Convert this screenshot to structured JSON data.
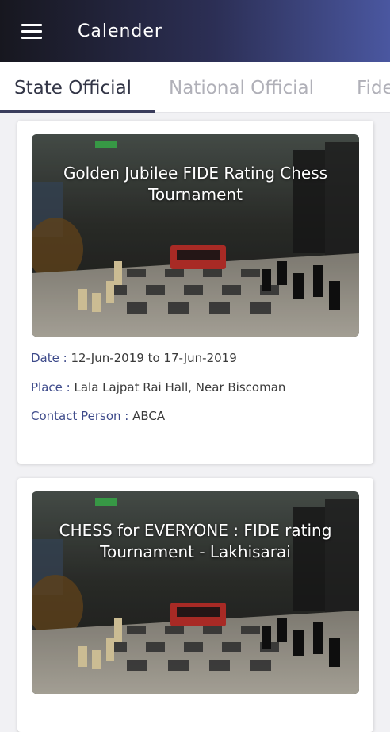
{
  "appbar": {
    "title": "Calender",
    "menu_icon": "hamburger-menu-icon"
  },
  "tabs": [
    {
      "label": "State Official",
      "active": true
    },
    {
      "label": "National Official",
      "active": false
    },
    {
      "label": "Fide",
      "active": false
    }
  ],
  "events": [
    {
      "title": "Golden Jubilee FIDE Rating Chess Tournament",
      "date_label": "Date : ",
      "date_value": "12-Jun-2019 to 17-Jun-2019",
      "place_label": "Place : ",
      "place_value": "Lala Lajpat Rai Hall, Near Biscoman",
      "contact_label": "Contact Person : ",
      "contact_value": "ABCA"
    },
    {
      "title": "CHESS for EVERYONE : FIDE rating Tournament - Lakhisarai"
    }
  ],
  "colors": {
    "accent": "#3d4a8a",
    "appbar_start": "#17171f",
    "appbar_end": "#4a57a0"
  }
}
